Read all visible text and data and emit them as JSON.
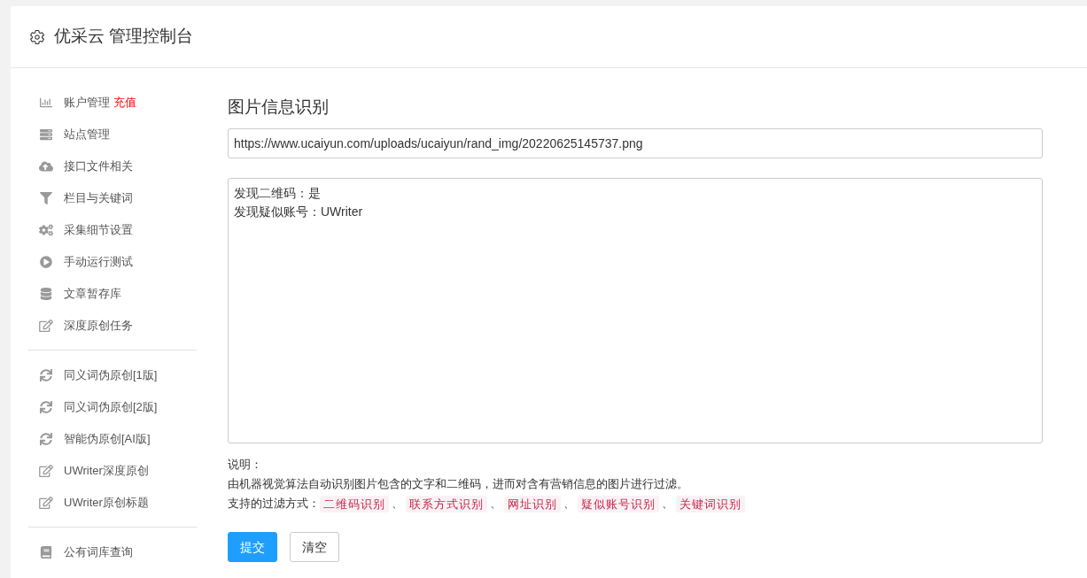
{
  "header": {
    "title": "优采云 管理控制台"
  },
  "sidebar": {
    "groups": [
      [
        {
          "label": "账户管理",
          "badge": "充值"
        },
        {
          "label": "站点管理"
        },
        {
          "label": "接口文件相关"
        },
        {
          "label": "栏目与关键词"
        },
        {
          "label": "采集细节设置"
        },
        {
          "label": "手动运行测试"
        },
        {
          "label": "文章暂存库"
        },
        {
          "label": "深度原创任务"
        }
      ],
      [
        {
          "label": "同义词伪原创[1版]"
        },
        {
          "label": "同义词伪原创[2版]"
        },
        {
          "label": "智能伪原创[AI版]"
        },
        {
          "label": "UWriter深度原创"
        },
        {
          "label": "UWriter原创标题"
        }
      ],
      [
        {
          "label": "公有词库查询"
        }
      ]
    ]
  },
  "main": {
    "title": "图片信息识别",
    "url_field": {
      "value": "https://www.ucaiyun.com/uploads/ucaiyun/rand_img/20220625145737.png"
    },
    "result_box": {
      "lines": [
        "发现二维码：是",
        "发现疑似账号：UWriter"
      ]
    },
    "notes": {
      "heading": "说明：",
      "description": "由机器视觉算法自动识别图片包含的文字和二维码，进而对含有营销信息的图片进行过滤。",
      "methods_label": "支持的过滤方式：",
      "methods": [
        {
          "label": "二维码识别",
          "separator": "、"
        },
        {
          "label": "联系方式识别",
          "separator": "、"
        },
        {
          "label": "网址识别",
          "separator": "、"
        },
        {
          "label": "疑似账号识别",
          "separator": "、"
        },
        {
          "label": "关键词识别"
        }
      ]
    },
    "buttons": [
      {
        "label": "提交",
        "kind": "primary"
      },
      {
        "label": "清空",
        "kind": "default"
      }
    ]
  }
}
